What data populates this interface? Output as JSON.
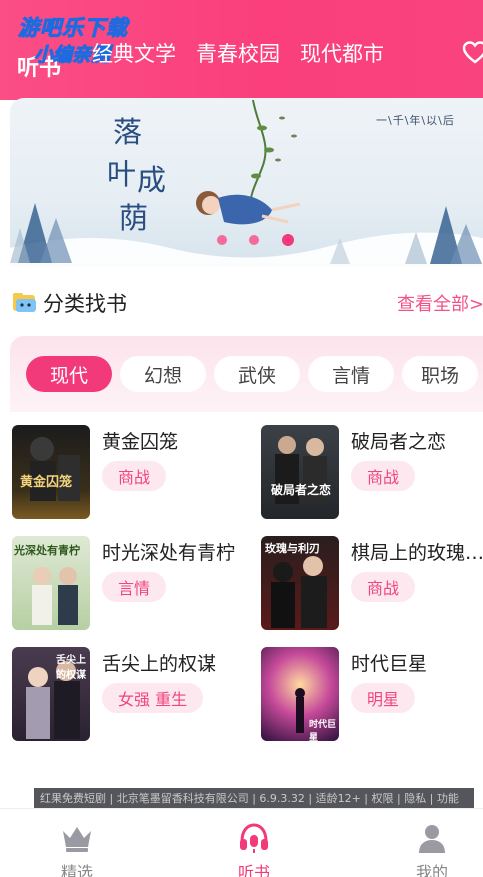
{
  "watermark": {
    "line1": "游吧乐下载",
    "line2": "小编亲测",
    "logo_text": "听书"
  },
  "top_tabs": [
    "经典文学",
    "青春校园",
    "现代都市"
  ],
  "banner": {
    "title_chars": [
      "落",
      "叶",
      "成",
      "荫"
    ],
    "subtitle": "一\\千\\年\\以\\后"
  },
  "section": {
    "title": "分类找书",
    "view_all": "查看全部>"
  },
  "categories": [
    "现代",
    "幻想",
    "武侠",
    "言情",
    "职场"
  ],
  "books": [
    {
      "title": "黄金囚笼",
      "tag": "商战",
      "cover_text": "黄金囚笼"
    },
    {
      "title": "破局者之恋",
      "tag": "商战",
      "cover_text": "破局者之恋"
    },
    {
      "title": "时光深处有青柠",
      "tag": "言情",
      "cover_text": "光深处有青柠"
    },
    {
      "title": "棋局上的玫瑰…",
      "tag": "商战",
      "cover_text": "玫瑰与利刃"
    },
    {
      "title": "舌尖上的权谋",
      "tag": "女强 重生",
      "cover_text": "舌尖上的权谋"
    },
    {
      "title": "时代巨星",
      "tag": "明星",
      "cover_text": "时代巨星"
    }
  ],
  "footer_strip": "红果免费短剧 | 北京笔墨留香科技有限公司 | 6.9.3.32 | 适龄12+ | 权限 | 隐私 | 功能",
  "bottom_nav": [
    {
      "label": "精选",
      "icon": "crown-icon"
    },
    {
      "label": "听书",
      "icon": "headphones-icon"
    },
    {
      "label": "我的",
      "icon": "profile-icon"
    }
  ],
  "colors": {
    "brand": "#fa3f7c",
    "accent_pink": "#f2397a",
    "tag_bg": "#fde8ef"
  }
}
